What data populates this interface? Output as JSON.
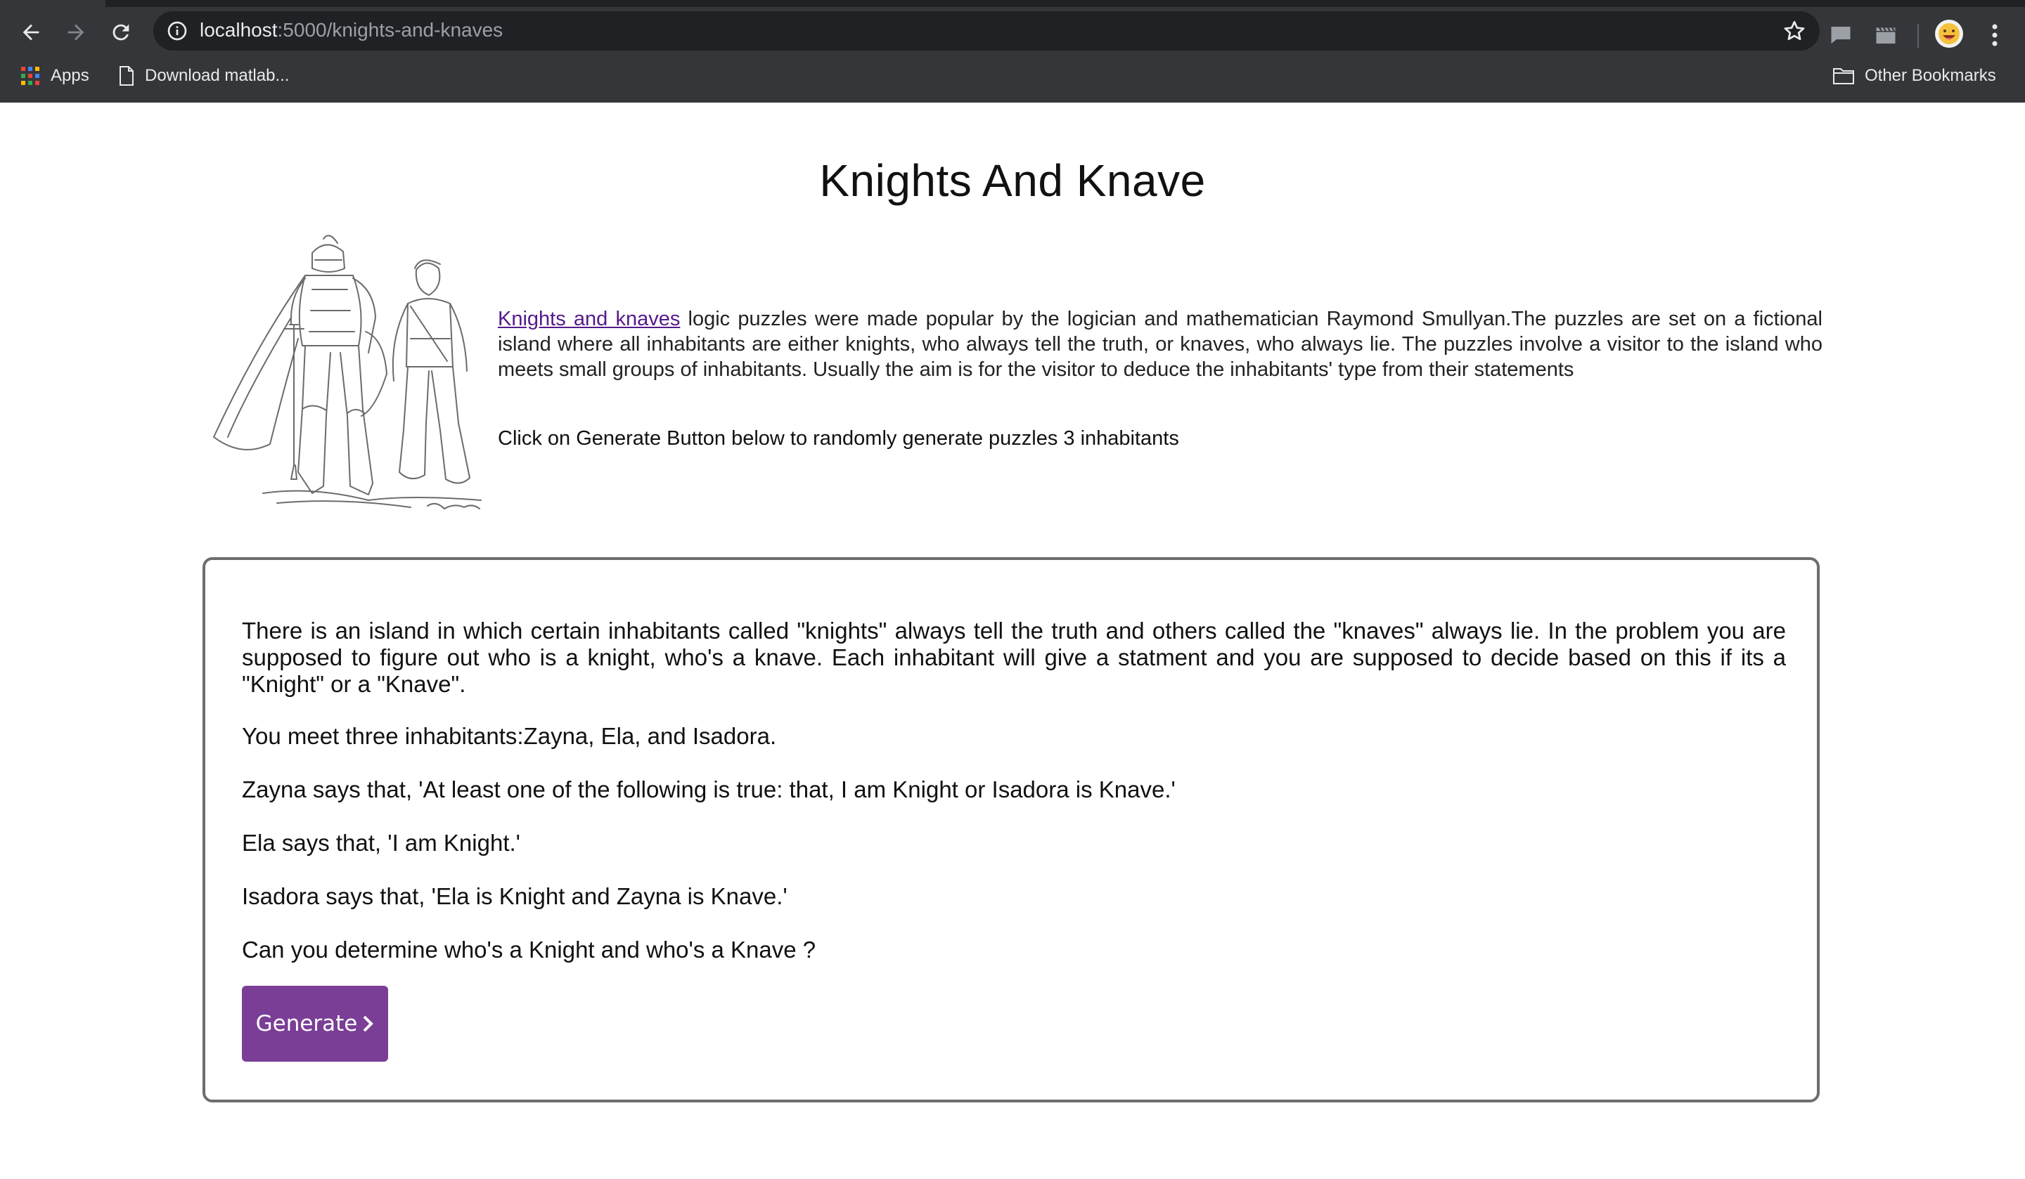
{
  "browser": {
    "url_host": "localhost",
    "url_path": ":5000/knights-and-knaves",
    "bookmarks": [
      {
        "label": "Apps"
      },
      {
        "label": "Download matlab..."
      }
    ],
    "other_bookmarks_label": "Other Bookmarks"
  },
  "page": {
    "title": "Knights And Knave",
    "intro": {
      "link_text": "Knights and knaves",
      "text": " logic puzzles were made popular by the logician and mathematician Raymond Smullyan.The puzzles are set on a fictional island where all inhabitants are either knights, who always tell the truth, or knaves, who always lie. The puzzles involve a visitor to the island who meets small groups of inhabitants. Usually the aim is for the visitor to deduce the inhabitants' type from their statements"
    },
    "hint": "Click on Generate Button below to randomly generate puzzles 3 inhabitants",
    "puzzle": {
      "description": "There is an island in which certain inhabitants called \"knights\" always tell the truth and others called the \"knaves\" always lie. In the problem you are supposed to figure out who is a knight, who's a knave. Each inhabitant will give a statment and you are supposed to decide based on this if its a \"Knight\" or a \"Knave\".",
      "meet": "You meet three inhabitants:Zayna, Ela, and Isadora.",
      "statements": [
        "Zayna says that, 'At least one of the following is true: that, I am Knight or Isadora is Knave.'",
        "Ela says that, 'I am Knight.'",
        "Isadora says that, 'Ela is Knight and Zayna is Knave.'"
      ],
      "question": "Can you determine who's a Knight and who's a Knave ?",
      "generate_label": "Generate"
    }
  },
  "colors": {
    "button": "#7a3e96",
    "link": "#551a8b",
    "chrome": "#35363a"
  }
}
